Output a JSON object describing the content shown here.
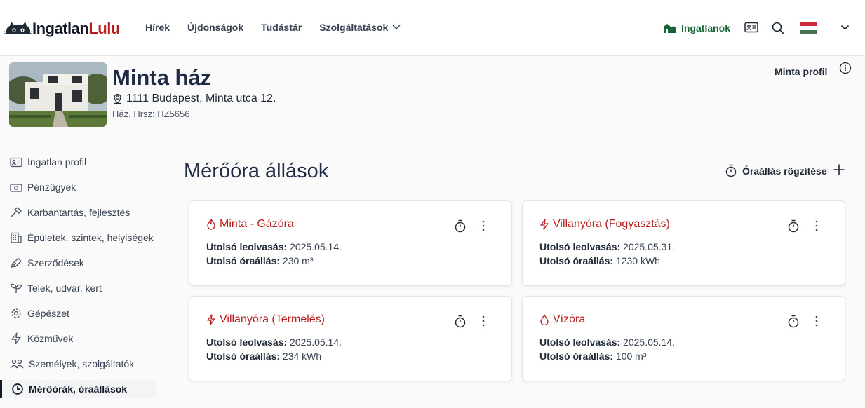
{
  "brand": {
    "part1": "Ingatlan",
    "part2": "Lulu"
  },
  "nav": {
    "items": [
      "Hírek",
      "Újdonságok",
      "Tudástár",
      "Szolgáltatások"
    ],
    "ingatlanok": "Ingatlanok"
  },
  "property": {
    "title": "Minta ház",
    "address": "1111 Budapest, Minta utca 12.",
    "meta": "Ház, Hrsz: HZ5656",
    "profile_label": "Minta profil"
  },
  "sidebar": {
    "items": [
      {
        "label": "Ingatlan profil",
        "icon": "id-card-icon"
      },
      {
        "label": "Pénzügyek",
        "icon": "banknote-icon"
      },
      {
        "label": "Karbantartás, fejlesztés",
        "icon": "hammer-icon"
      },
      {
        "label": "Épületek, szintek, helyiségek",
        "icon": "building-icon"
      },
      {
        "label": "Szerződések",
        "icon": "pen-icon"
      },
      {
        "label": "Telek, udvar, kert",
        "icon": "sprout-icon"
      },
      {
        "label": "Gépészet",
        "icon": "gear-icon"
      },
      {
        "label": "Közművek",
        "icon": "lightning-icon"
      },
      {
        "label": "Személyek, szolgáltatók",
        "icon": "people-icon"
      },
      {
        "label": "Mérőórák, óraállások",
        "icon": "clock-icon"
      }
    ]
  },
  "main": {
    "title": "Mérőóra állások",
    "add_reading": "Óraállás rögzítése"
  },
  "meters": [
    {
      "name": "Minta - Gázóra",
      "icon": "flame-icon",
      "last_reading_label": "Utolsó leolvasás:",
      "last_reading": "2025.05.14.",
      "last_value_label": "Utolsó óraállás:",
      "last_value": "230 m³"
    },
    {
      "name": "Villanyóra (Fogyasztás)",
      "icon": "lightning-icon",
      "last_reading_label": "Utolsó leolvasás:",
      "last_reading": "2025.05.31.",
      "last_value_label": "Utolsó óraállás:",
      "last_value": "1230 kWh"
    },
    {
      "name": "Villanyóra (Termelés)",
      "icon": "lightning-icon",
      "last_reading_label": "Utolsó leolvasás:",
      "last_reading": "2025.05.14.",
      "last_value_label": "Utolsó óraállás:",
      "last_value": "234 kWh"
    },
    {
      "name": "Vízóra",
      "icon": "droplet-icon",
      "last_reading_label": "Utolsó leolvasás:",
      "last_reading": "2025.05.14.",
      "last_value_label": "Utolsó óraállás:",
      "last_value": "100 m³"
    }
  ],
  "colors": {
    "brand_red": "#b91c1c",
    "brand_green": "#166534",
    "flag": [
      "#ce2939",
      "#ffffff",
      "#477050"
    ]
  }
}
